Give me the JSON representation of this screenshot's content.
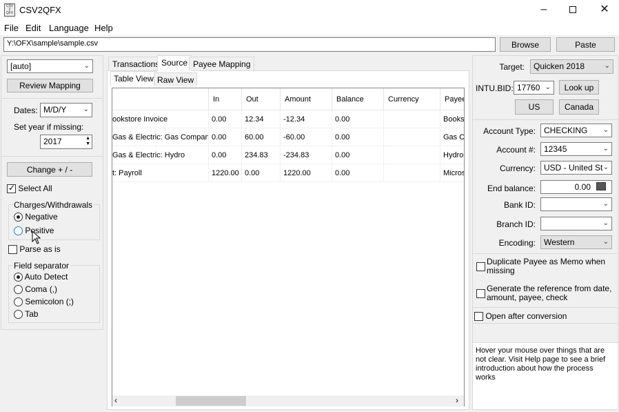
{
  "window": {
    "title": "CSV2QFX",
    "icon_text": "CSV 2 QFX"
  },
  "menu": [
    "File",
    "Edit",
    "Language",
    "Help"
  ],
  "path": {
    "value": "Y:\\OFX\\sample\\sample.csv",
    "browse_label": "Browse",
    "paste_label": "Paste"
  },
  "left": {
    "mapping_value": "[auto]",
    "review_label": "Review Mapping",
    "dates_label": "Dates:",
    "dates_value": "M/D/Y",
    "year_label": "Set year if missing:",
    "year_value": "2017",
    "change_label": "Change + / -",
    "select_all_label": "Select All",
    "charges_title": "Charges/Withdrawals",
    "negative_label": "Negative",
    "positive_label": "Positive",
    "parse_label": "Parse as is",
    "separator_title": "Field separator",
    "sep_auto": "Auto Detect",
    "sep_coma": "Coma (,)",
    "sep_semicolon": "Semicolon (;)",
    "sep_tab": "Tab"
  },
  "tabs": [
    "Transactions",
    "Source",
    "Payee Mapping"
  ],
  "subtabs": [
    "Table View",
    "Raw View"
  ],
  "grid": {
    "columns": [
      "In",
      "Out",
      "Amount",
      "Balance",
      "Currency",
      "Payee"
    ],
    "rows": [
      {
        "desc": "ookstore Invoice",
        "in": "0.00",
        "out": "12.34",
        "amount": "-12.34",
        "balance": "0.00",
        "currency": "",
        "payee": "Bookst"
      },
      {
        "desc": "Gas & Electric: Gas Company",
        "in": "0.00",
        "out": "60.00",
        "amount": "-60.00",
        "balance": "0.00",
        "currency": "",
        "payee": "Gas Co"
      },
      {
        "desc": "Gas & Electric: Hydro",
        "in": "0.00",
        "out": "234.83",
        "amount": "-234.83",
        "balance": "0.00",
        "currency": "",
        "payee": "Hydro"
      },
      {
        "desc": "t: Payroll",
        "in": "1220.00",
        "out": "0.00",
        "amount": "1220.00",
        "balance": "0.00",
        "currency": "",
        "payee": "Micros"
      }
    ]
  },
  "right": {
    "target_label": "Target:",
    "target_value": "Quicken 2018",
    "intubid_label": "INTU.BID:",
    "intubid_value": "17760",
    "lookup_label": "Look up",
    "us_label": "US",
    "canada_label": "Canada",
    "account_type_label": "Account Type:",
    "account_type_value": "CHECKING",
    "account_num_label": "Account #:",
    "account_num_value": "12345",
    "currency_label": "Currency:",
    "currency_value": "USD - United Sta",
    "end_balance_label": "End balance:",
    "end_balance_value": "0.00",
    "bank_id_label": "Bank ID:",
    "branch_id_label": "Branch ID:",
    "encoding_label": "Encoding:",
    "encoding_value": "Western",
    "dup_payee_label": "Duplicate Payee as Memo when missing",
    "gen_ref_label": "Generate the reference from date, amount, payee, check",
    "open_after_label": "Open after conversion",
    "help_text": "Hover your mouse over things that are not clear. Visit Help page to see a brief introduction about how the process works"
  }
}
